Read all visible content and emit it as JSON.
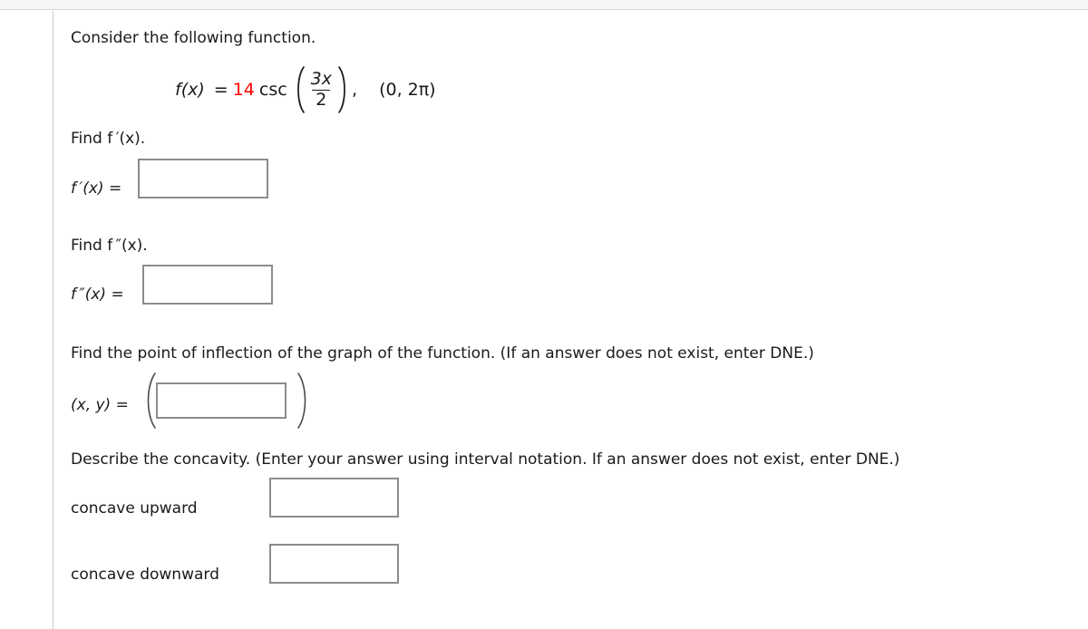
{
  "page": {
    "background_color": "#ffffff",
    "rule_color": "#cccccc",
    "top_band_color": "#f6f6f6",
    "accent_color": "#ff0000",
    "input_border_color": "#8c8c8c"
  },
  "intro": {
    "text": "Consider the following function."
  },
  "equation": {
    "function_name": "f(x)",
    "equals": "=",
    "coefficient": "14",
    "coefficient_color": "#ff0000",
    "trig_function": "csc",
    "fraction_numerator": "3x",
    "fraction_denominator": "2",
    "comma": ",",
    "interval": "(0, 2π)",
    "full_text": "f(x) = 14 csc(3x/2),  (0, 2π)"
  },
  "first_derivative": {
    "prompt": "Find f ′(x).",
    "label": "f ′(x)  =",
    "input_value": "",
    "input_placeholder": ""
  },
  "second_derivative": {
    "prompt": "Find f ″(x).",
    "label": "f ″(x)  =",
    "input_value": "",
    "input_placeholder": ""
  },
  "inflection": {
    "prompt": "Find the point of inflection of the graph of the function. (If an answer does not exist, enter DNE.)",
    "label": "(x, y)  =",
    "open_paren": "(",
    "close_paren": ")",
    "input_value": "",
    "input_placeholder": ""
  },
  "concavity": {
    "prompt": "Describe the concavity. (Enter your answer using interval notation. If an answer does not exist, enter DNE.)",
    "rows": [
      {
        "label": "concave upward",
        "input_value": "",
        "input_placeholder": ""
      },
      {
        "label": "concave downward",
        "input_value": "",
        "input_placeholder": ""
      }
    ]
  }
}
